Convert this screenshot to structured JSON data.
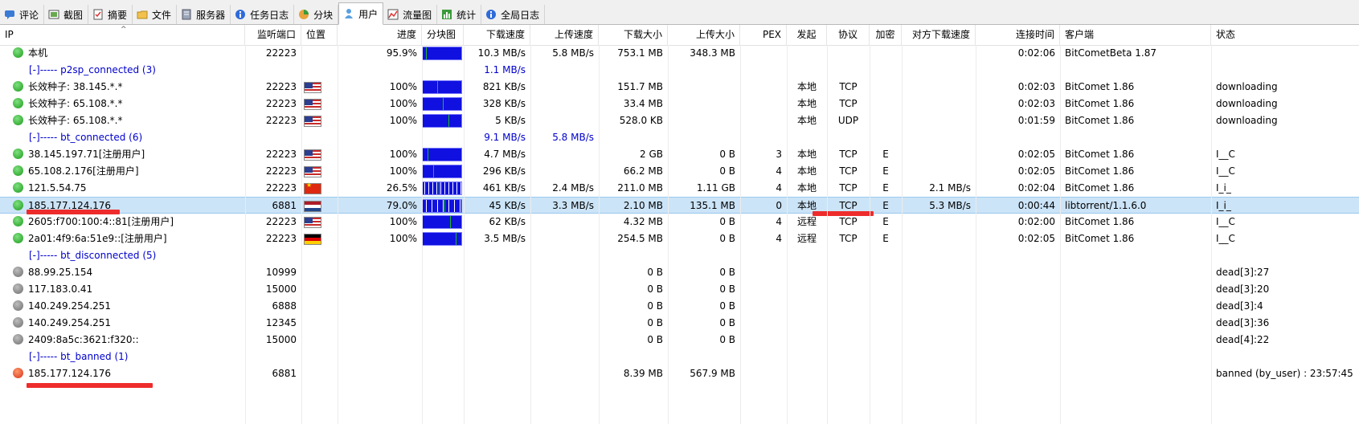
{
  "tabs": [
    {
      "label": "评论",
      "icon": "comment-icon"
    },
    {
      "label": "截图",
      "icon": "screenshot-icon"
    },
    {
      "label": "摘要",
      "icon": "summary-icon"
    },
    {
      "label": "文件",
      "icon": "folder-icon"
    },
    {
      "label": "服务器",
      "icon": "server-icon"
    },
    {
      "label": "任务日志",
      "icon": "info-icon"
    },
    {
      "label": "分块",
      "icon": "pie-icon"
    },
    {
      "label": "用户",
      "icon": "user-icon",
      "active": true
    },
    {
      "label": "流量图",
      "icon": "chart-icon"
    },
    {
      "label": "统计",
      "icon": "stats-icon"
    },
    {
      "label": "全局日志",
      "icon": "info-icon"
    }
  ],
  "columns": {
    "ip": "IP",
    "port": "监听端口",
    "location": "位置",
    "progress": "进度",
    "pieces": "分块图",
    "down": "下载速度",
    "up": "上传速度",
    "downsize": "下载大小",
    "upsize": "上传大小",
    "pex": "PEX",
    "initiator": "发起",
    "protocol": "协议",
    "encrypt": "加密",
    "peer_down": "对方下载速度",
    "conn_time": "连接时间",
    "client": "客户端",
    "status": "状态"
  },
  "rows": [
    {
      "type": "peer",
      "icon": "ok",
      "ip": "本机",
      "port": "22223",
      "flag": "",
      "progress": "95.9%",
      "pieces": "full",
      "down": "10.3 MB/s",
      "up": "5.8 MB/s",
      "downsize": "753.1 MB",
      "upsize": "348.3 MB",
      "pex": "",
      "initiator": "",
      "protocol": "",
      "encrypt": "",
      "peer_down": "",
      "conn_time": "0:02:06",
      "client": "BitCometBeta 1.87",
      "status": ""
    },
    {
      "type": "group",
      "label": "[-]----- p2sp_connected (3)",
      "down": "1.1 MB/s",
      "up": ""
    },
    {
      "type": "peer",
      "icon": "ok",
      "ip": "长效种子: 38.145.*.*",
      "port": "22223",
      "flag": "us",
      "progress": "100%",
      "pieces": "full",
      "down": "821 KB/s",
      "up": "",
      "downsize": "151.7 MB",
      "upsize": "",
      "pex": "",
      "initiator": "本地",
      "protocol": "TCP",
      "encrypt": "",
      "peer_down": "",
      "conn_time": "0:02:03",
      "client": "BitComet 1.86",
      "status": "downloading"
    },
    {
      "type": "peer",
      "icon": "ok",
      "ip": "长效种子: 65.108.*.*",
      "port": "22223",
      "flag": "us",
      "progress": "100%",
      "pieces": "full",
      "down": "328 KB/s",
      "up": "",
      "downsize": "33.4 MB",
      "upsize": "",
      "pex": "",
      "initiator": "本地",
      "protocol": "TCP",
      "encrypt": "",
      "peer_down": "",
      "conn_time": "0:02:03",
      "client": "BitComet 1.86",
      "status": "downloading"
    },
    {
      "type": "peer",
      "icon": "ok",
      "ip": "长效种子: 65.108.*.*",
      "port": "22223",
      "flag": "us",
      "progress": "100%",
      "pieces": "full",
      "down": "5 KB/s",
      "up": "",
      "downsize": "528.0 KB",
      "upsize": "",
      "pex": "",
      "initiator": "本地",
      "protocol": "UDP",
      "encrypt": "",
      "peer_down": "",
      "conn_time": "0:01:59",
      "client": "BitComet 1.86",
      "status": "downloading"
    },
    {
      "type": "group",
      "label": "[-]----- bt_connected (6)",
      "down": "9.1 MB/s",
      "up": "5.8 MB/s"
    },
    {
      "type": "peer",
      "icon": "ok",
      "ip": "38.145.197.71[注册用户]",
      "port": "22223",
      "flag": "us",
      "progress": "100%",
      "pieces": "full",
      "down": "4.7 MB/s",
      "up": "",
      "downsize": "2 GB",
      "upsize": "0 B",
      "pex": "3",
      "initiator": "本地",
      "protocol": "TCP",
      "encrypt": "E",
      "peer_down": "",
      "conn_time": "0:02:05",
      "client": "BitComet 1.86",
      "status": "I__C"
    },
    {
      "type": "peer",
      "icon": "ok",
      "ip": "65.108.2.176[注册用户]",
      "port": "22223",
      "flag": "us",
      "progress": "100%",
      "pieces": "full",
      "down": "296 KB/s",
      "up": "",
      "downsize": "66.2 MB",
      "upsize": "0 B",
      "pex": "4",
      "initiator": "本地",
      "protocol": "TCP",
      "encrypt": "E",
      "peer_down": "",
      "conn_time": "0:02:05",
      "client": "BitComet 1.86",
      "status": "I__C"
    },
    {
      "type": "peer",
      "icon": "ok",
      "ip": "121.5.54.75",
      "port": "22223",
      "flag": "cn",
      "progress": "26.5%",
      "pieces": "partial",
      "down": "461 KB/s",
      "up": "2.4 MB/s",
      "downsize": "211.0 MB",
      "upsize": "1.11 GB",
      "pex": "4",
      "initiator": "本地",
      "protocol": "TCP",
      "encrypt": "E",
      "peer_down": "2.1 MB/s",
      "conn_time": "0:02:04",
      "client": "BitComet 1.86",
      "status": "I_i_"
    },
    {
      "type": "peer",
      "icon": "ok",
      "selected": true,
      "ip": "185.177.124.176",
      "port": "6881",
      "flag": "nl",
      "progress": "79.0%",
      "pieces": "mostly",
      "down": "45 KB/s",
      "up": "3.3 MB/s",
      "downsize": "2.10 MB",
      "upsize": "135.1 MB",
      "pex": "0",
      "initiator": "本地",
      "protocol": "TCP",
      "encrypt": "E",
      "peer_down": "5.3 MB/s",
      "conn_time": "0:00:44",
      "client": "libtorrent/1.1.6.0",
      "status": "I_i_"
    },
    {
      "type": "peer",
      "icon": "ok",
      "ip": "2605:f700:100:4::81[注册用户]",
      "port": "22223",
      "flag": "us",
      "progress": "100%",
      "pieces": "full",
      "down": "62 KB/s",
      "up": "",
      "downsize": "4.32 MB",
      "upsize": "0 B",
      "pex": "4",
      "initiator": "远程",
      "protocol": "TCP",
      "encrypt": "E",
      "peer_down": "",
      "conn_time": "0:02:00",
      "client": "BitComet 1.86",
      "status": "I__C"
    },
    {
      "type": "peer",
      "icon": "ok",
      "ip": "2a01:4f9:6a:51e9::[注册用户]",
      "port": "22223",
      "flag": "de",
      "progress": "100%",
      "pieces": "full",
      "down": "3.5 MB/s",
      "up": "",
      "downsize": "254.5 MB",
      "upsize": "0 B",
      "pex": "4",
      "initiator": "远程",
      "protocol": "TCP",
      "encrypt": "E",
      "peer_down": "",
      "conn_time": "0:02:05",
      "client": "BitComet 1.86",
      "status": "I__C"
    },
    {
      "type": "group",
      "label": "[-]----- bt_disconnected (5)",
      "down": "",
      "up": ""
    },
    {
      "type": "peer",
      "icon": "dead",
      "ip": "88.99.25.154",
      "port": "10999",
      "flag": "",
      "progress": "",
      "pieces": "",
      "down": "",
      "up": "",
      "downsize": "0 B",
      "upsize": "0 B",
      "pex": "",
      "initiator": "",
      "protocol": "",
      "encrypt": "",
      "peer_down": "",
      "conn_time": "",
      "client": "",
      "status": "dead[3]:27"
    },
    {
      "type": "peer",
      "icon": "dead",
      "ip": "117.183.0.41",
      "port": "15000",
      "flag": "",
      "progress": "",
      "pieces": "",
      "down": "",
      "up": "",
      "downsize": "0 B",
      "upsize": "0 B",
      "pex": "",
      "initiator": "",
      "protocol": "",
      "encrypt": "",
      "peer_down": "",
      "conn_time": "",
      "client": "",
      "status": "dead[3]:20"
    },
    {
      "type": "peer",
      "icon": "dead",
      "ip": "140.249.254.251",
      "port": "6888",
      "flag": "",
      "progress": "",
      "pieces": "",
      "down": "",
      "up": "",
      "downsize": "0 B",
      "upsize": "0 B",
      "pex": "",
      "initiator": "",
      "protocol": "",
      "encrypt": "",
      "peer_down": "",
      "conn_time": "",
      "client": "",
      "status": "dead[3]:4"
    },
    {
      "type": "peer",
      "icon": "dead",
      "ip": "140.249.254.251",
      "port": "12345",
      "flag": "",
      "progress": "",
      "pieces": "",
      "down": "",
      "up": "",
      "downsize": "0 B",
      "upsize": "0 B",
      "pex": "",
      "initiator": "",
      "protocol": "",
      "encrypt": "",
      "peer_down": "",
      "conn_time": "",
      "client": "",
      "status": "dead[3]:36"
    },
    {
      "type": "peer",
      "icon": "dead",
      "ip": "2409:8a5c:3621:f320::",
      "port": "15000",
      "flag": "",
      "progress": "",
      "pieces": "",
      "down": "",
      "up": "",
      "downsize": "0 B",
      "upsize": "0 B",
      "pex": "",
      "initiator": "",
      "protocol": "",
      "encrypt": "",
      "peer_down": "",
      "conn_time": "",
      "client": "",
      "status": "dead[4]:22"
    },
    {
      "type": "group",
      "label": "[-]----- bt_banned (1)",
      "down": "",
      "up": ""
    },
    {
      "type": "peer",
      "icon": "banned",
      "ip": "185.177.124.176",
      "port": "6881",
      "flag": "",
      "progress": "",
      "pieces": "",
      "down": "",
      "up": "",
      "downsize": "8.39 MB",
      "upsize": "567.9 MB",
      "pex": "",
      "initiator": "",
      "protocol": "",
      "encrypt": "",
      "peer_down": "",
      "conn_time": "",
      "client": "",
      "status": "banned (by_user) : 23:57:45"
    }
  ]
}
